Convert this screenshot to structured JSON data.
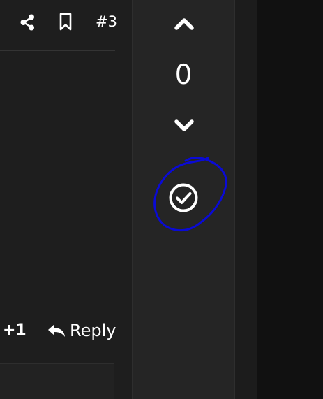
{
  "post": {
    "actions": {
      "share_icon": "share-icon",
      "bookmark_icon": "bookmark-icon",
      "post_number": "#3"
    },
    "footer": {
      "plus_one": "+1",
      "reply_icon": "reply-icon",
      "reply_label": "Reply"
    }
  },
  "voting": {
    "upvote_icon": "chevron-up-icon",
    "count": "0",
    "downvote_icon": "chevron-down-icon",
    "accept_icon": "check-circle-icon"
  },
  "colors": {
    "panel_bg": "#1e1e1e",
    "vote_bg": "#252525",
    "page_bg": "#121212",
    "text": "#ffffff",
    "annotation": "#0a0ad6"
  }
}
